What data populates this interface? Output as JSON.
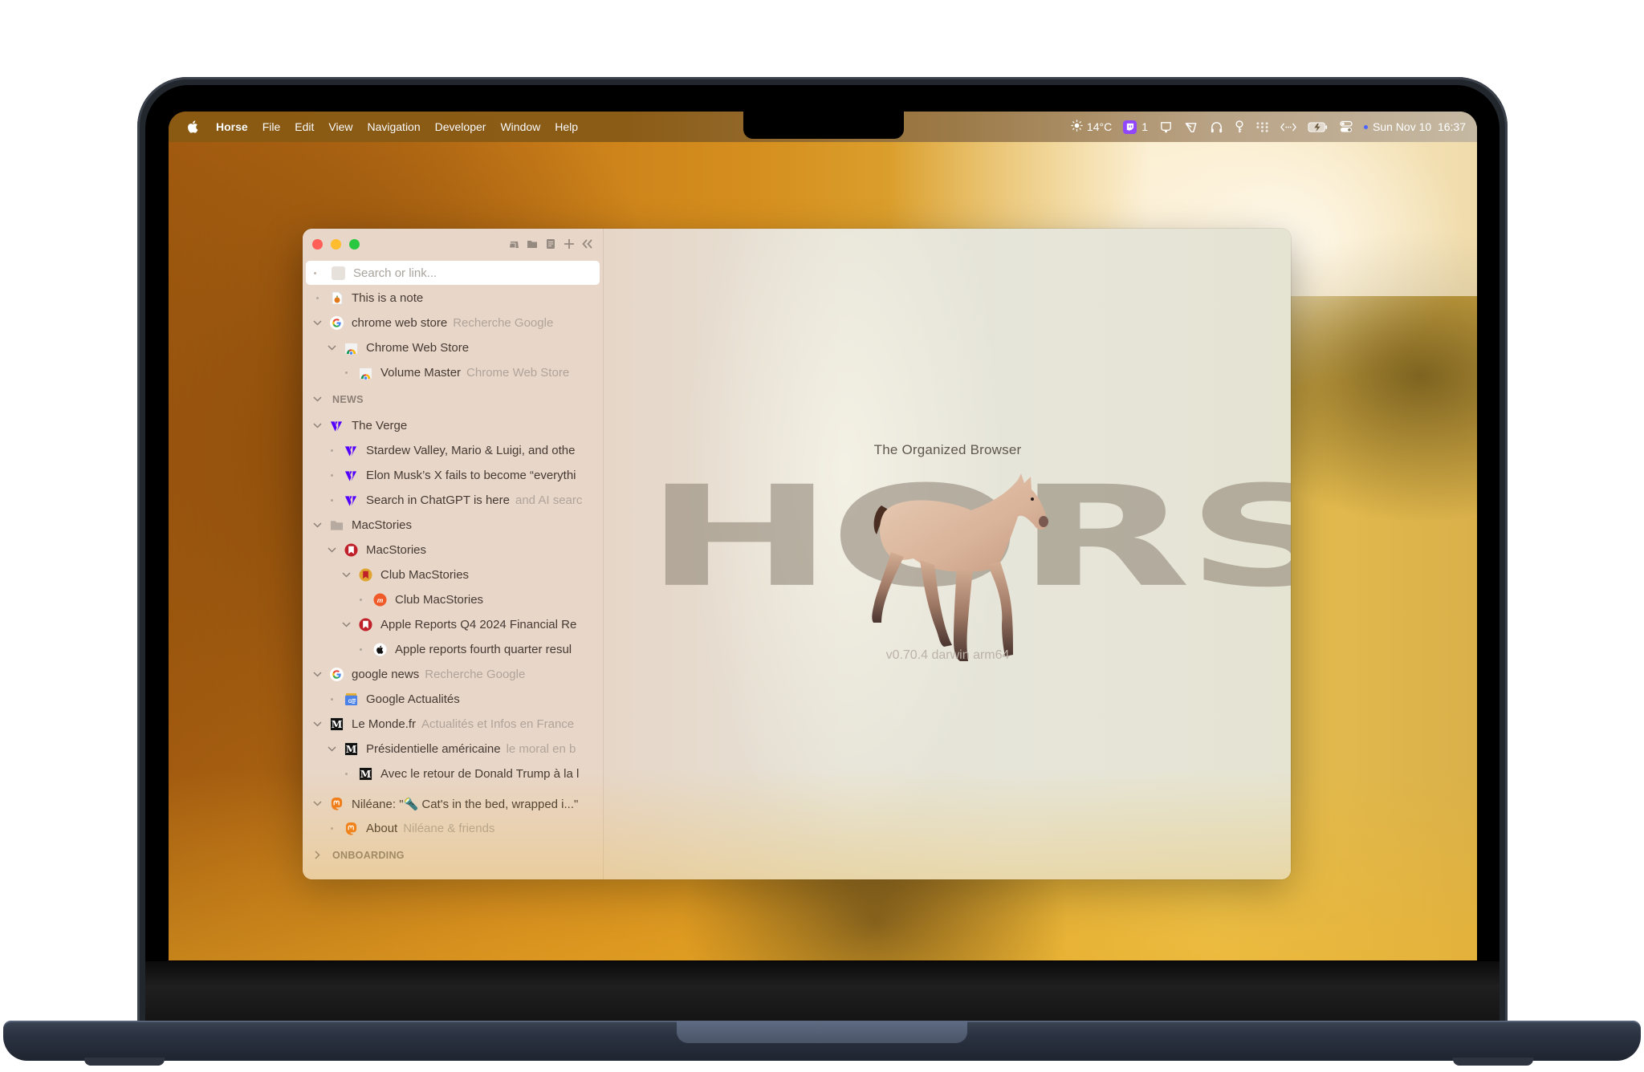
{
  "menubar": {
    "app_name": "Horse",
    "items": [
      "File",
      "Edit",
      "View",
      "Navigation",
      "Developer",
      "Window",
      "Help"
    ],
    "status": {
      "weather_temp": "14°C",
      "twitch_count": "1",
      "date": "Sun Nov 10",
      "time": "16:37"
    }
  },
  "window": {
    "toolbar_icons": [
      "tabs-icon",
      "folder-icon",
      "note-icon",
      "plus-icon",
      "collapse-sidebar-icon"
    ],
    "search": {
      "placeholder": "Search or link..."
    },
    "tree": [
      {
        "type": "item",
        "level": 0,
        "toggle": "bullet",
        "icon": "note-icon",
        "title": "This is a note",
        "subtitle": ""
      },
      {
        "type": "item",
        "level": 0,
        "toggle": "expanded",
        "icon": "google-icon",
        "title": "chrome web store",
        "subtitle": "Recherche Google"
      },
      {
        "type": "item",
        "level": 1,
        "toggle": "expanded",
        "icon": "chrome-web-store-icon",
        "title": "Chrome Web Store",
        "subtitle": ""
      },
      {
        "type": "item",
        "level": 2,
        "toggle": "bullet",
        "icon": "chrome-web-store-icon",
        "title": "Volume Master",
        "subtitle": "Chrome Web Store"
      },
      {
        "type": "section",
        "toggle": "expanded",
        "label": "NEWS"
      },
      {
        "type": "item",
        "level": 0,
        "toggle": "expanded",
        "icon": "verge-icon",
        "title": "The Verge",
        "subtitle": ""
      },
      {
        "type": "item",
        "level": 1,
        "toggle": "bullet",
        "icon": "verge-icon",
        "title": "Stardew Valley, Mario & Luigi, and othe",
        "subtitle": ""
      },
      {
        "type": "item",
        "level": 1,
        "toggle": "bullet",
        "icon": "verge-icon",
        "title": "Elon Musk’s X fails to become “everythi",
        "subtitle": ""
      },
      {
        "type": "item",
        "level": 1,
        "toggle": "bullet",
        "icon": "verge-icon",
        "title": "Search in ChatGPT is here",
        "subtitle": "and AI searc"
      },
      {
        "type": "item",
        "level": 0,
        "toggle": "expanded",
        "icon": "folder-icon",
        "title": "MacStories",
        "subtitle": ""
      },
      {
        "type": "item",
        "level": 1,
        "toggle": "expanded",
        "icon": "macstories-icon",
        "title": "MacStories",
        "subtitle": ""
      },
      {
        "type": "item",
        "level": 2,
        "toggle": "expanded",
        "icon": "club-macstories-icon",
        "title": "Club MacStories",
        "subtitle": ""
      },
      {
        "type": "item",
        "level": 3,
        "toggle": "bullet",
        "icon": "club-m-icon",
        "title": "Club MacStories",
        "subtitle": ""
      },
      {
        "type": "item",
        "level": 2,
        "toggle": "expanded",
        "icon": "macstories-icon",
        "title": "Apple Reports Q4 2024 Financial Re",
        "subtitle": ""
      },
      {
        "type": "item",
        "level": 3,
        "toggle": "bullet",
        "icon": "apple-icon",
        "title": "Apple reports fourth quarter resul",
        "subtitle": ""
      },
      {
        "type": "item",
        "level": 0,
        "toggle": "expanded",
        "icon": "google-icon",
        "title": "google news",
        "subtitle": "Recherche Google"
      },
      {
        "type": "item",
        "level": 1,
        "toggle": "bullet",
        "icon": "google-news-icon",
        "title": "Google Actualités",
        "subtitle": ""
      },
      {
        "type": "item",
        "level": 0,
        "toggle": "expanded",
        "icon": "le-monde-icon",
        "title": "Le Monde.fr",
        "subtitle": "Actualités et Infos en France"
      },
      {
        "type": "item",
        "level": 1,
        "toggle": "expanded",
        "icon": "le-monde-icon",
        "title": "Présidentielle américaine",
        "subtitle": "le moral en b"
      },
      {
        "type": "item",
        "level": 2,
        "toggle": "bullet",
        "icon": "le-monde-icon",
        "title": "Avec le retour de Donald Trump à la l",
        "subtitle": ""
      },
      {
        "type": "item",
        "level": 0,
        "toggle": "expanded",
        "icon": "mastodon-icon",
        "title": "Niléane: \"🔦 Cat's in the bed, wrapped i...\"",
        "subtitle": "",
        "gap_before": true
      },
      {
        "type": "item",
        "level": 1,
        "toggle": "bullet",
        "icon": "mastodon-icon",
        "title": "About",
        "subtitle": "Niléane & friends"
      },
      {
        "type": "section",
        "toggle": "collapsed",
        "label": "ONBOARDING"
      }
    ]
  },
  "content": {
    "tagline": "The Organized Browser",
    "wordmark": "HORSE",
    "version": "v0.70.4 darwin arm64"
  },
  "colors": {
    "accent_twitch": "#9147ff",
    "verge_purple": "#5200ff",
    "macstories_red": "#c0202a",
    "mastodon_orange": "#f07a1a"
  }
}
